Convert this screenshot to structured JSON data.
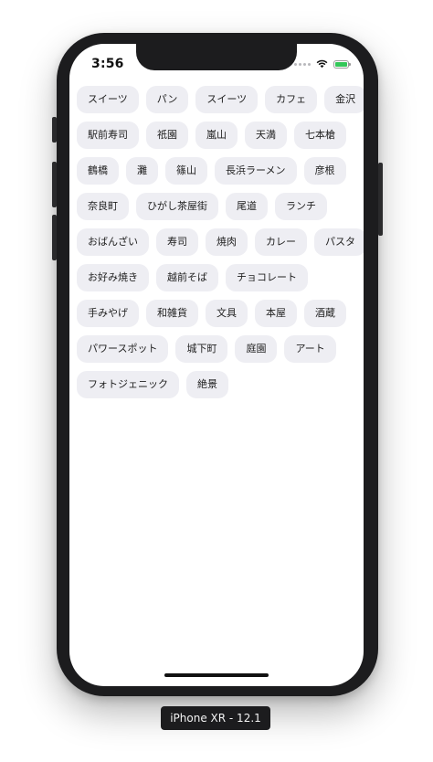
{
  "status_bar": {
    "time": "3:56",
    "icons": [
      "signal-dots-icon",
      "wifi-icon",
      "battery-charging-icon"
    ],
    "battery_color": "#34c759"
  },
  "tag_rows": [
    [
      "スイーツ",
      "パン",
      "スイーツ",
      "カフェ",
      "金沢"
    ],
    [
      "駅前寿司",
      "祇園",
      "嵐山",
      "天満",
      "七本槍"
    ],
    [
      "鶴橋",
      "灘",
      "篠山",
      "長浜ラーメン",
      "彦根"
    ],
    [
      "奈良町",
      "ひがし茶屋街",
      "尾道",
      "ランチ"
    ],
    [
      "おばんざい",
      "寿司",
      "焼肉",
      "カレー",
      "パスタ"
    ],
    [
      "お好み焼き",
      "越前そば",
      "チョコレート"
    ],
    [
      "手みやげ",
      "和雑貨",
      "文具",
      "本屋",
      "酒蔵"
    ],
    [
      "パワースポット",
      "城下町",
      "庭園",
      "アート"
    ],
    [
      "フォトジェニック",
      "絶景"
    ]
  ],
  "device_label": "iPhone XR - 12.1"
}
